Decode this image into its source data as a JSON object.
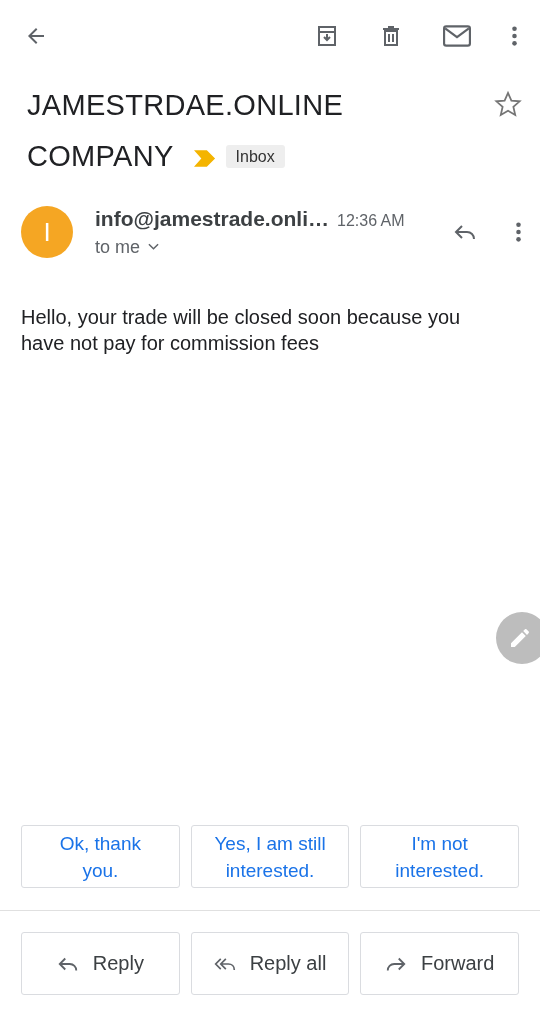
{
  "toolbar": {
    "actions": [
      {
        "kind": "archive"
      },
      {
        "kind": "delete"
      },
      {
        "kind": "mail"
      },
      {
        "kind": "more"
      }
    ]
  },
  "subject_lines": [
    "JAMESTRDAE.ONLINE",
    "COMPANY"
  ],
  "important": true,
  "label": "Inbox",
  "starred": false,
  "sender": {
    "initial": "I",
    "name": "info@jamestrade.onli…",
    "time": "12:36 AM",
    "recipient": "to me"
  },
  "body": "Hello, your trade will be closed soon because you have not pay for commission fees",
  "smart_replies": [
    "Ok, thank you.",
    "Yes, I am still interested.",
    "I'm not interested."
  ],
  "actions": [
    {
      "kind": "reply",
      "label": "Reply"
    },
    {
      "kind": "reply_all",
      "label": "Reply all"
    },
    {
      "kind": "forward",
      "label": "Forward"
    }
  ]
}
